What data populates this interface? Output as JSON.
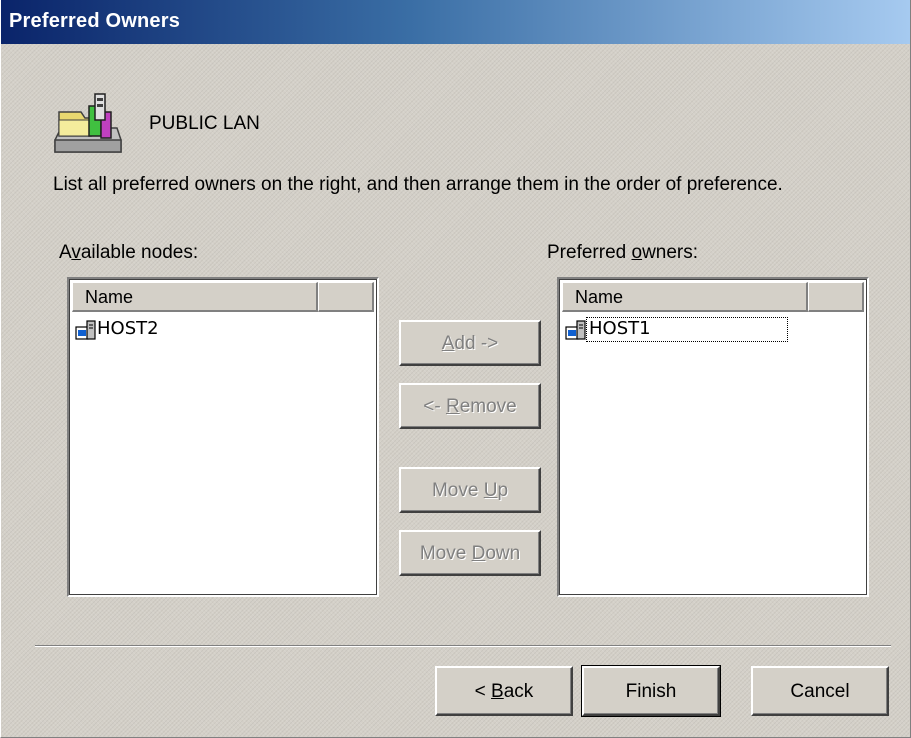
{
  "window": {
    "title": "Preferred Owners"
  },
  "header": {
    "resource_name": "PUBLIC LAN",
    "icon": "resource-folder-icon"
  },
  "instructions": "List all preferred owners on the right, and then arrange them in the order of preference.",
  "available": {
    "label_pre": "A",
    "label_key": "v",
    "label_post": "ailable nodes:",
    "columns": [
      "Name"
    ],
    "items": [
      {
        "name": "HOST2",
        "icon": "server-node-icon"
      }
    ]
  },
  "preferred": {
    "label_pre": "Preferred ",
    "label_key": "o",
    "label_post": "wners:",
    "columns": [
      "Name"
    ],
    "items": [
      {
        "name": "HOST1",
        "icon": "server-node-icon",
        "focused": true
      }
    ]
  },
  "buttons": {
    "add": {
      "key": "A",
      "post": "dd ->",
      "enabled": false
    },
    "remove": {
      "pre": "<- ",
      "key": "R",
      "post": "emove",
      "enabled": false
    },
    "move_up": {
      "pre": "Move ",
      "key": "U",
      "post": "p",
      "enabled": false
    },
    "move_down": {
      "pre": "Move ",
      "key": "D",
      "post": "own",
      "enabled": false
    },
    "back": {
      "pre": "< ",
      "key": "B",
      "post": "ack"
    },
    "finish": {
      "label": "Finish"
    },
    "cancel": {
      "label": "Cancel"
    }
  },
  "colors": {
    "titlebar_start": "#0a246a",
    "titlebar_end": "#a6caf0",
    "face": "#d4d0c8",
    "disabled_text": "#808080"
  }
}
